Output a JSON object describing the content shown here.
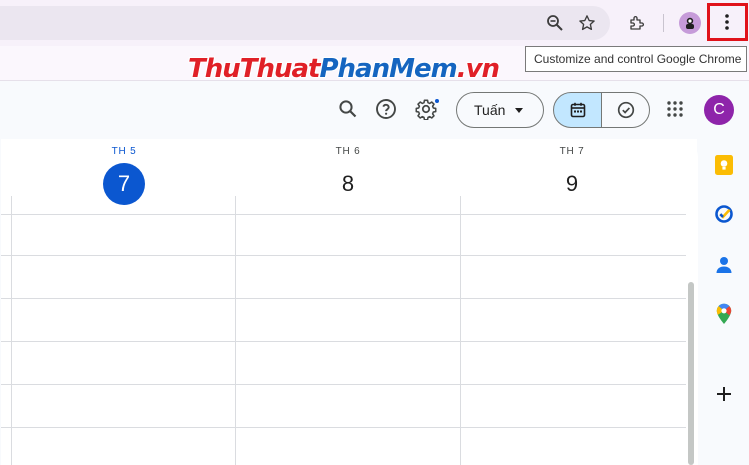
{
  "browser": {
    "tooltip": "Customize and control Google Chrome",
    "icons": [
      "zoom-out-icon",
      "star-icon",
      "extensions-icon",
      "profile-icon",
      "more-vert-icon"
    ],
    "menu_highlight_color": "#e0121a"
  },
  "watermark": {
    "part1": "ThuThuat",
    "part2": "PhanMem",
    "part3": ".vn",
    "color1": "#e02027",
    "color2": "#1565c0"
  },
  "calendar": {
    "view_label": "Tuấn",
    "avatar_letter": "C",
    "days": [
      {
        "name": "TH 5",
        "number": "7",
        "today": true
      },
      {
        "name": "TH 6",
        "number": "8",
        "today": false
      },
      {
        "name": "TH 7",
        "number": "9",
        "today": false
      }
    ],
    "colors": {
      "accent": "#0b57d0",
      "avatar": "#8e24aa",
      "selected_segment": "#c2e7ff"
    },
    "side_panel_icons": [
      "keep-icon",
      "tasks-icon",
      "contacts-icon",
      "maps-icon",
      "add-icon"
    ]
  }
}
